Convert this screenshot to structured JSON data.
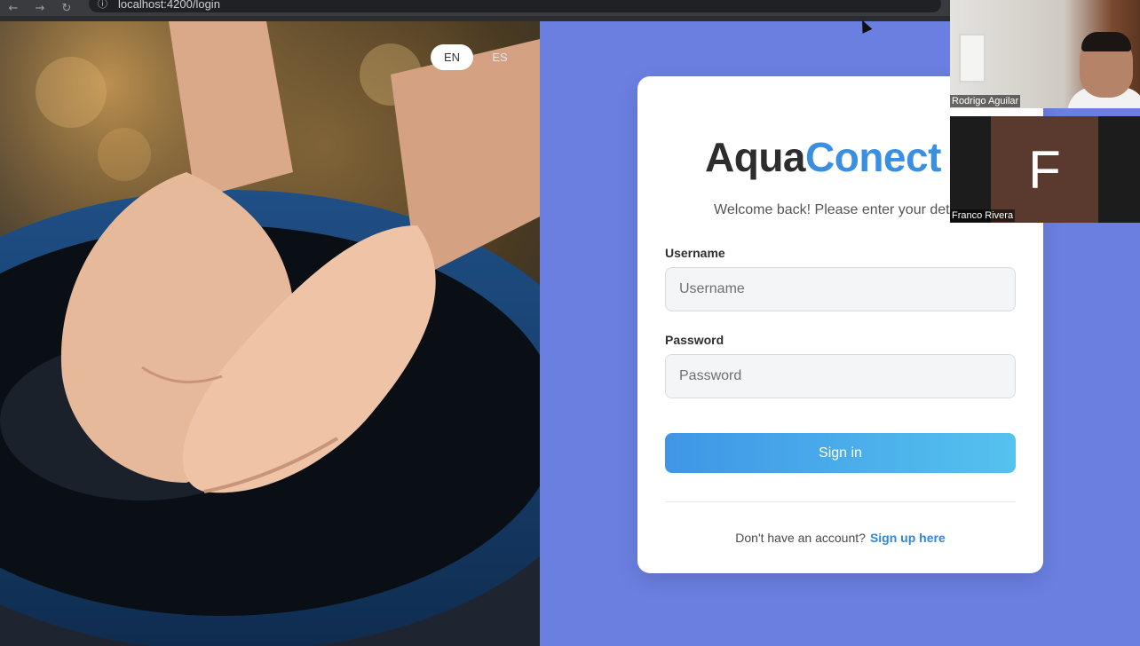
{
  "browser": {
    "url": "localhost:4200/login",
    "back_icon": "arrow-left-icon",
    "forward_icon": "arrow-right-icon",
    "reload_icon": "reload-icon",
    "info_icon": "info-icon"
  },
  "language_switch": {
    "options": [
      {
        "label": "EN",
        "selected": true
      },
      {
        "label": "ES",
        "selected": false
      }
    ]
  },
  "login_card": {
    "brand_part1": "Aqua",
    "brand_part2": "Conect",
    "subtitle": "Welcome back! Please enter your deta",
    "username_label": "Username",
    "username_placeholder": "Username",
    "password_label": "Password",
    "password_placeholder": "Password",
    "signin_label": "Sign in",
    "signup_prompt": "Don't have an account?",
    "signup_link": "Sign up here"
  },
  "video_call": {
    "participants": [
      {
        "name": "Rodrigo Aguilar"
      },
      {
        "name": "Franco Rivera",
        "initial": "F"
      }
    ]
  },
  "colors": {
    "panel_blue": "#6a7fe0",
    "brand_blue": "#3b8fe0",
    "button_gradient_start": "#3f96e6",
    "button_gradient_end": "#55c2ef",
    "link_blue": "#2f87d8"
  }
}
